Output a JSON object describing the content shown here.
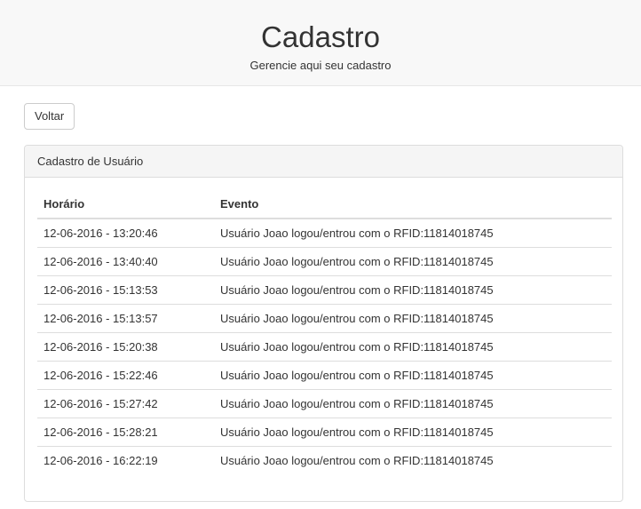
{
  "header": {
    "title": "Cadastro",
    "subtitle": "Gerencie aqui seu cadastro"
  },
  "toolbar": {
    "back_label": "Voltar"
  },
  "panel": {
    "title": "Cadastro de Usuário",
    "columns": [
      "Horário",
      "Evento"
    ],
    "rows": [
      {
        "time": "12-06-2016 - 13:20:46",
        "event": "Usuário Joao logou/entrou com o RFID:11814018745"
      },
      {
        "time": "12-06-2016 - 13:40:40",
        "event": "Usuário Joao logou/entrou com o RFID:11814018745"
      },
      {
        "time": "12-06-2016 - 15:13:53",
        "event": "Usuário Joao logou/entrou com o RFID:11814018745"
      },
      {
        "time": "12-06-2016 - 15:13:57",
        "event": "Usuário Joao logou/entrou com o RFID:11814018745"
      },
      {
        "time": "12-06-2016 - 15:20:38",
        "event": "Usuário Joao logou/entrou com o RFID:11814018745"
      },
      {
        "time": "12-06-2016 - 15:22:46",
        "event": "Usuário Joao logou/entrou com o RFID:11814018745"
      },
      {
        "time": "12-06-2016 - 15:27:42",
        "event": "Usuário Joao logou/entrou com o RFID:11814018745"
      },
      {
        "time": "12-06-2016 - 15:28:21",
        "event": "Usuário Joao logou/entrou com o RFID:11814018745"
      },
      {
        "time": "12-06-2016 - 16:22:19",
        "event": "Usuário Joao logou/entrou com o RFID:11814018745"
      }
    ]
  }
}
